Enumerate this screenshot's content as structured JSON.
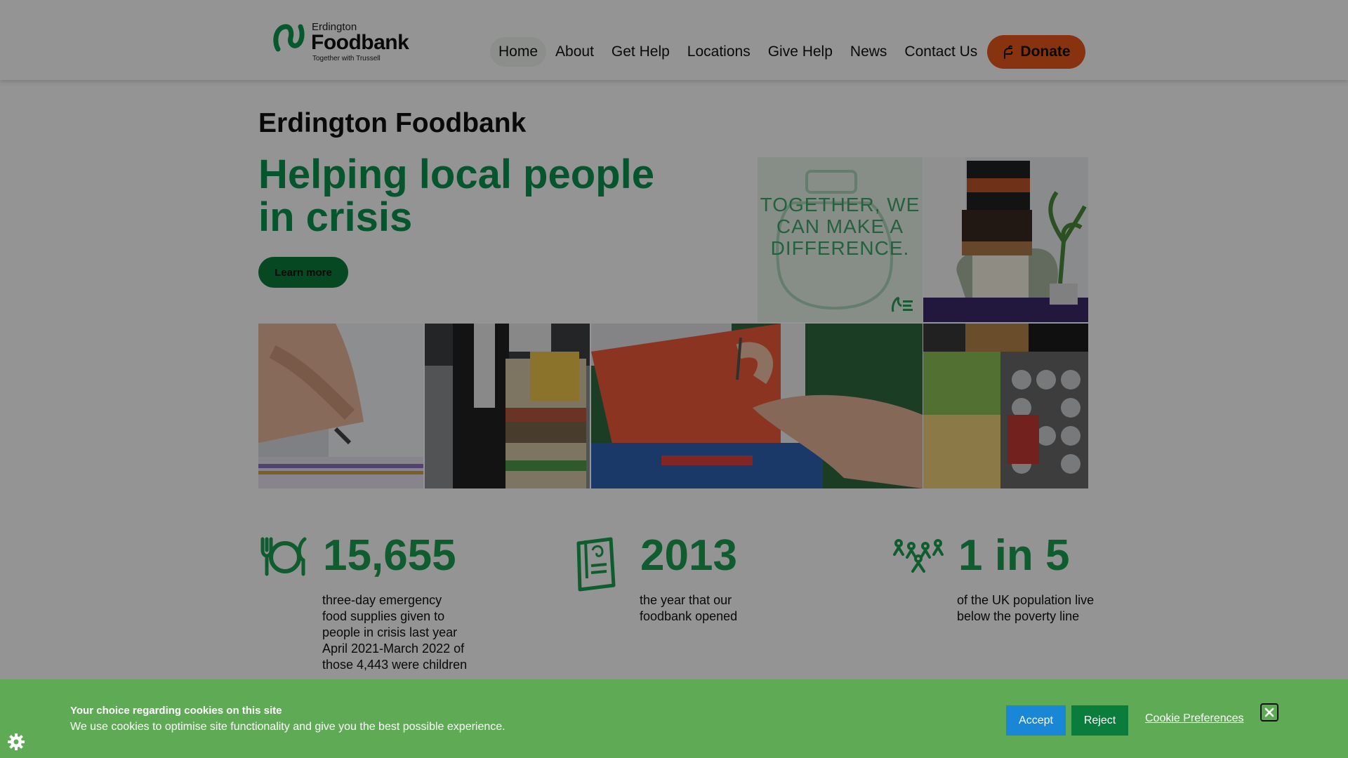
{
  "header": {
    "logo": {
      "small": "Erdington",
      "name": "Foodbank",
      "tagline": "Together with Trussell"
    },
    "nav": [
      {
        "label": "Home",
        "active": true
      },
      {
        "label": "About"
      },
      {
        "label": "Get Help"
      },
      {
        "label": "Locations"
      },
      {
        "label": "Give Help"
      },
      {
        "label": "News"
      },
      {
        "label": "Contact Us"
      }
    ],
    "donate_label": "Donate"
  },
  "hero": {
    "title": "Erdington Foodbank",
    "headline": "Helping local people in crisis",
    "button": "Learn more"
  },
  "gallery": {
    "tagline": "TOGETHER, WE CAN MAKE A DIFFERENCE.",
    "photos": [
      "checklist-writing-photo",
      "volunteer-with-trolley-photo",
      "slow-cooker-boxes-photo",
      "form-signing-photo",
      "food-parcel-packing-photo"
    ]
  },
  "stats": [
    {
      "icon": "plate-cutlery-icon",
      "number": "15,655",
      "desc": "three-day emergency food supplies given to people in crisis last year April 2021-March 2022 of those 4,443 were children"
    },
    {
      "icon": "book-icon",
      "number": "2013",
      "desc": "the year that our foodbank opened"
    },
    {
      "icon": "people-group-icon",
      "number": "1 in 5",
      "desc": "of the UK population live below the poverty line"
    }
  ],
  "cookie": {
    "heading": "Your choice regarding cookies on this site",
    "text": "We use cookies to optimise site functionality and give you the best possible experience.",
    "accept": "Accept",
    "reject": "Reject",
    "preferences": "Cookie Preferences"
  },
  "colors": {
    "brand_green": "#09954f",
    "button_green": "#0a7d3c",
    "donate_orange": "#e8581a",
    "cookie_bar": "#5fab55",
    "accept_blue": "#1a86d6"
  }
}
